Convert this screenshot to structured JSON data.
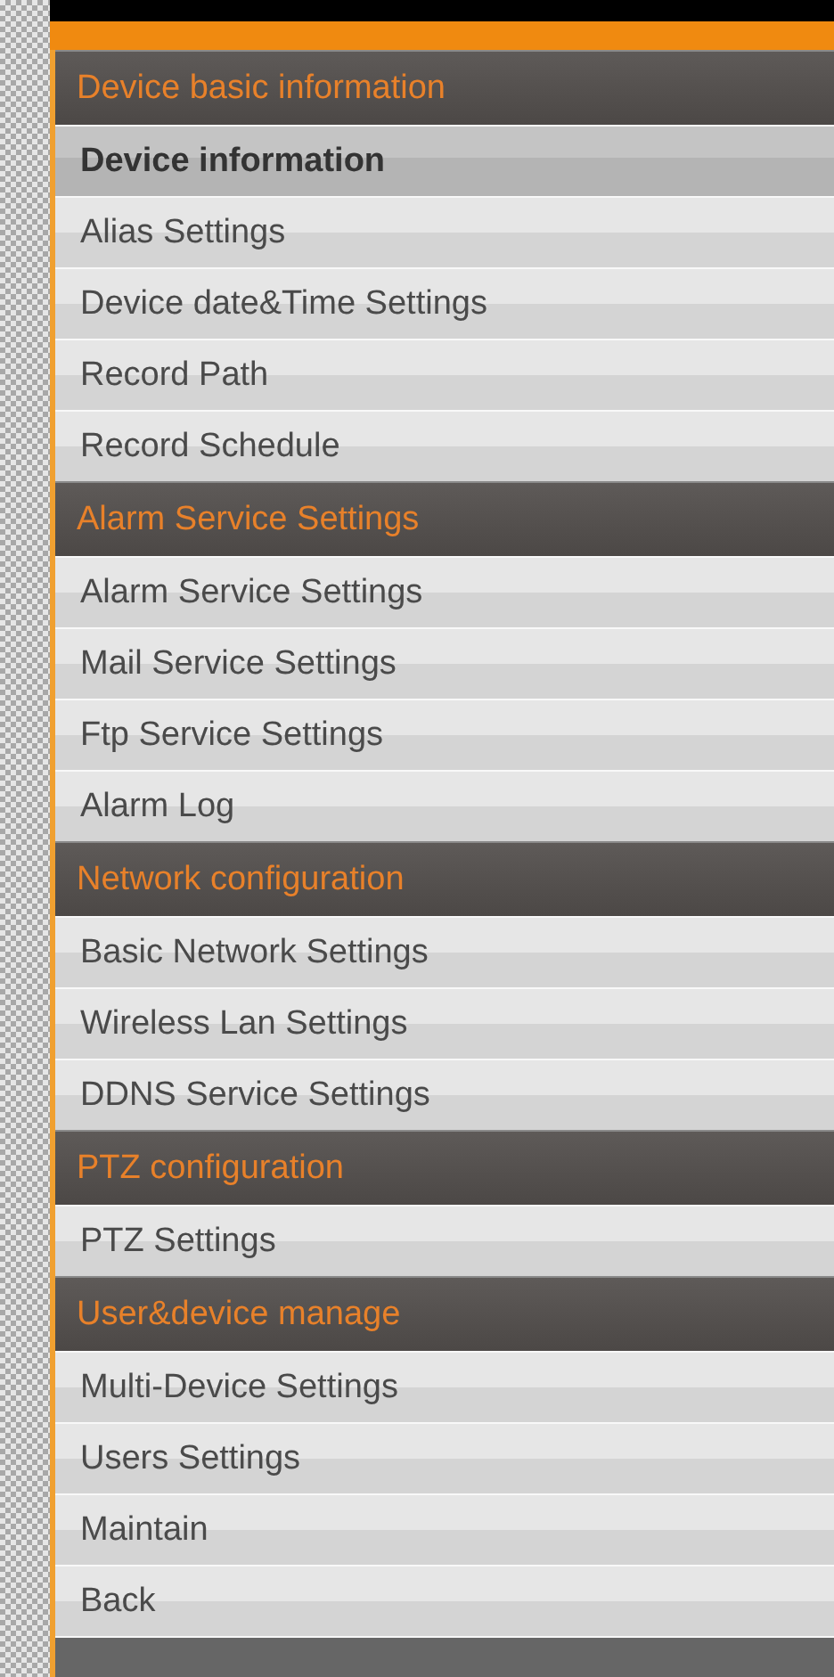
{
  "sections": [
    {
      "title": "Device basic information",
      "items": [
        {
          "label": "Device information",
          "selected": true
        },
        {
          "label": "Alias Settings",
          "selected": false
        },
        {
          "label": "Device date&Time Settings",
          "selected": false
        },
        {
          "label": "Record Path",
          "selected": false
        },
        {
          "label": "Record Schedule",
          "selected": false
        }
      ]
    },
    {
      "title": "Alarm Service Settings",
      "items": [
        {
          "label": "Alarm Service Settings",
          "selected": false
        },
        {
          "label": "Mail Service Settings",
          "selected": false
        },
        {
          "label": "Ftp Service Settings",
          "selected": false
        },
        {
          "label": "Alarm Log",
          "selected": false
        }
      ]
    },
    {
      "title": "Network configuration",
      "items": [
        {
          "label": "Basic Network Settings",
          "selected": false
        },
        {
          "label": "Wireless Lan Settings",
          "selected": false
        },
        {
          "label": "DDNS Service Settings",
          "selected": false
        }
      ]
    },
    {
      "title": "PTZ configuration",
      "items": [
        {
          "label": "PTZ Settings",
          "selected": false
        }
      ]
    },
    {
      "title": "User&device manage",
      "items": [
        {
          "label": "Multi-Device Settings",
          "selected": false
        },
        {
          "label": "Users Settings",
          "selected": false
        },
        {
          "label": "Maintain",
          "selected": false
        },
        {
          "label": "Back",
          "selected": false
        }
      ]
    }
  ]
}
